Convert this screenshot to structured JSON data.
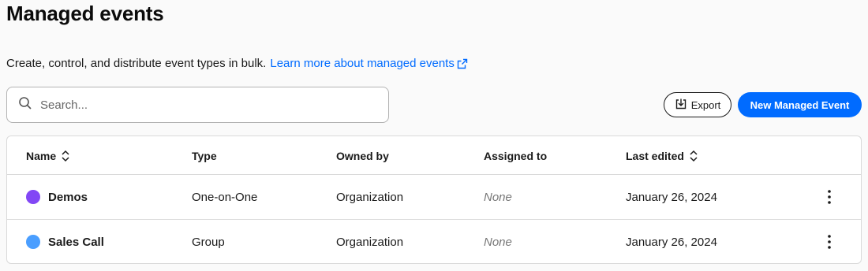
{
  "page": {
    "title": "Managed events",
    "description": "Create, control, and distribute event types in bulk.",
    "learn_more_link": "Learn more about managed events"
  },
  "search": {
    "placeholder": "Search..."
  },
  "actions": {
    "export_label": "Export",
    "new_label": "New Managed Event"
  },
  "colors": {
    "accent": "#006bff",
    "demos_dot": "#8247f5",
    "sales_dot": "#4a9eff"
  },
  "table": {
    "columns": {
      "name": "Name",
      "type": "Type",
      "owned_by": "Owned by",
      "assigned_to": "Assigned to",
      "last_edited": "Last edited"
    },
    "rows": [
      {
        "name": "Demos",
        "type": "One-on-One",
        "owned_by": "Organization",
        "assigned_to": "None",
        "last_edited": "January 26, 2024",
        "dot_color": "#8247f5"
      },
      {
        "name": "Sales Call",
        "type": "Group",
        "owned_by": "Organization",
        "assigned_to": "None",
        "last_edited": "January 26, 2024",
        "dot_color": "#4a9eff"
      }
    ]
  }
}
